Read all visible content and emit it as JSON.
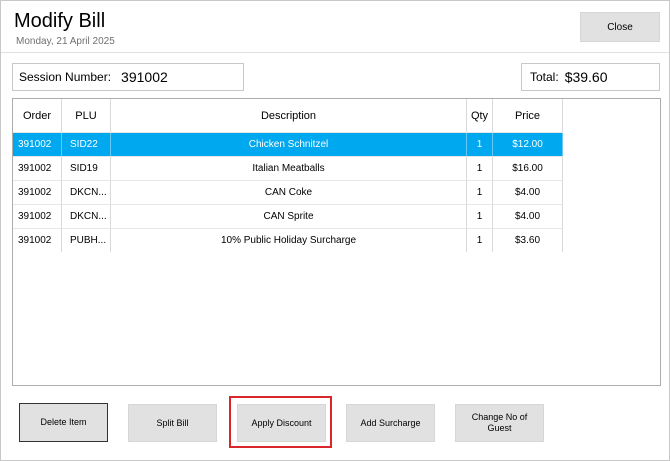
{
  "header": {
    "title": "Modify Bill",
    "date": "Monday, 21 April 2025",
    "close_label": "Close"
  },
  "session": {
    "label": "Session Number:",
    "value": "391002"
  },
  "total": {
    "label": "Total:",
    "value": "$39.60"
  },
  "table": {
    "columns": [
      "Order",
      "PLU",
      "Description",
      "Qty",
      "Price"
    ],
    "rows": [
      {
        "order": "391002",
        "plu": "SID22",
        "description": "Chicken Schnitzel",
        "qty": "1",
        "price": "$12.00",
        "selected": true
      },
      {
        "order": "391002",
        "plu": "SID19",
        "description": "Italian Meatballs",
        "qty": "1",
        "price": "$16.00",
        "selected": false
      },
      {
        "order": "391002",
        "plu": "DKCN...",
        "description": "CAN Coke",
        "qty": "1",
        "price": "$4.00",
        "selected": false
      },
      {
        "order": "391002",
        "plu": "DKCN...",
        "description": "CAN Sprite",
        "qty": "1",
        "price": "$4.00",
        "selected": false
      },
      {
        "order": "391002",
        "plu": "PUBH...",
        "description": "10% Public Holiday Surcharge",
        "qty": "1",
        "price": "$3.60",
        "selected": false
      }
    ],
    "selected_color": "#00a8f0"
  },
  "actions": {
    "delete_item": "Delete Item",
    "split_bill": "Split Bill",
    "apply_discount": "Apply Discount",
    "add_surcharge": "Add Surcharge",
    "change_guests": "Change No of Guest"
  },
  "colors": {
    "highlight": "#d9262b",
    "button_bg": "#e1e1e1"
  }
}
